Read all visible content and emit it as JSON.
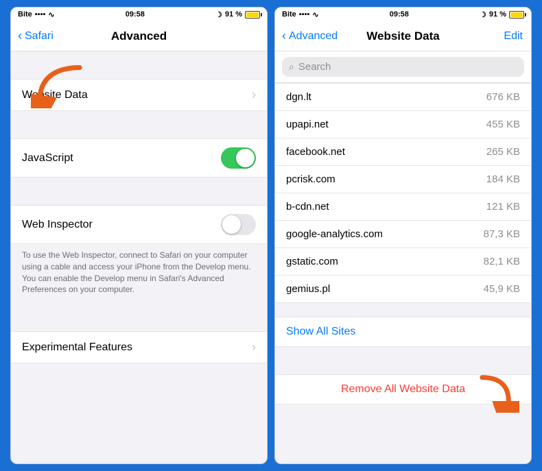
{
  "left_phone": {
    "status": {
      "carrier": "Bite",
      "time": "09:58",
      "battery_percent": "91 %"
    },
    "nav": {
      "back_label": "Safari",
      "title": "Advanced"
    },
    "sections": [
      {
        "items": [
          {
            "label": "Website Data",
            "type": "chevron"
          }
        ]
      },
      {
        "items": [
          {
            "label": "JavaScript",
            "type": "toggle",
            "value": true
          }
        ]
      },
      {
        "items": [
          {
            "label": "Web Inspector",
            "type": "toggle",
            "value": false
          }
        ],
        "description": "To use the Web Inspector, connect to Safari on your computer using a cable and access your iPhone from the Develop menu. You can enable the Develop menu in Safari's Advanced Preferences on your computer."
      },
      {
        "items": [
          {
            "label": "Experimental Features",
            "type": "chevron"
          }
        ]
      }
    ]
  },
  "right_phone": {
    "status": {
      "carrier": "Bite",
      "time": "09:58",
      "battery_percent": "91 %"
    },
    "nav": {
      "back_label": "Advanced",
      "title": "Website Data",
      "right_action": "Edit"
    },
    "search": {
      "placeholder": "Search"
    },
    "data_items": [
      {
        "domain": "dgn.lt",
        "size": "676 KB"
      },
      {
        "domain": "upapi.net",
        "size": "455 KB"
      },
      {
        "domain": "facebook.net",
        "size": "265 KB"
      },
      {
        "domain": "pcrisk.com",
        "size": "184 KB"
      },
      {
        "domain": "b-cdn.net",
        "size": "121 KB"
      },
      {
        "domain": "google-analytics.com",
        "size": "87,3 KB"
      },
      {
        "domain": "gstatic.com",
        "size": "82,1 KB"
      },
      {
        "domain": "gemius.pl",
        "size": "45,9 KB"
      }
    ],
    "show_all_label": "Show All Sites",
    "remove_all_label": "Remove All Website Data"
  }
}
